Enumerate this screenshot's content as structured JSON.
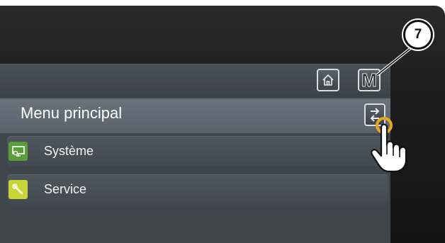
{
  "header": {
    "home_icon": "home-icon",
    "menu_button_label": "M"
  },
  "page": {
    "title": "Menu principal",
    "back_icon": "back-return-icon"
  },
  "menu": {
    "items": [
      {
        "label": "Système",
        "icon": "computer-settings-icon",
        "icon_color": "#5a9e3c"
      },
      {
        "label": "Service",
        "icon": "wrench-icon",
        "icon_color": "#c8d43a"
      }
    ]
  },
  "annotation": {
    "callout_number": "7",
    "pointer_icon": "pointing-hand-icon"
  },
  "colors": {
    "screen_bg": "#3e454b",
    "title_bar": "#626b73",
    "highlight_ring": "#e6a91c"
  }
}
